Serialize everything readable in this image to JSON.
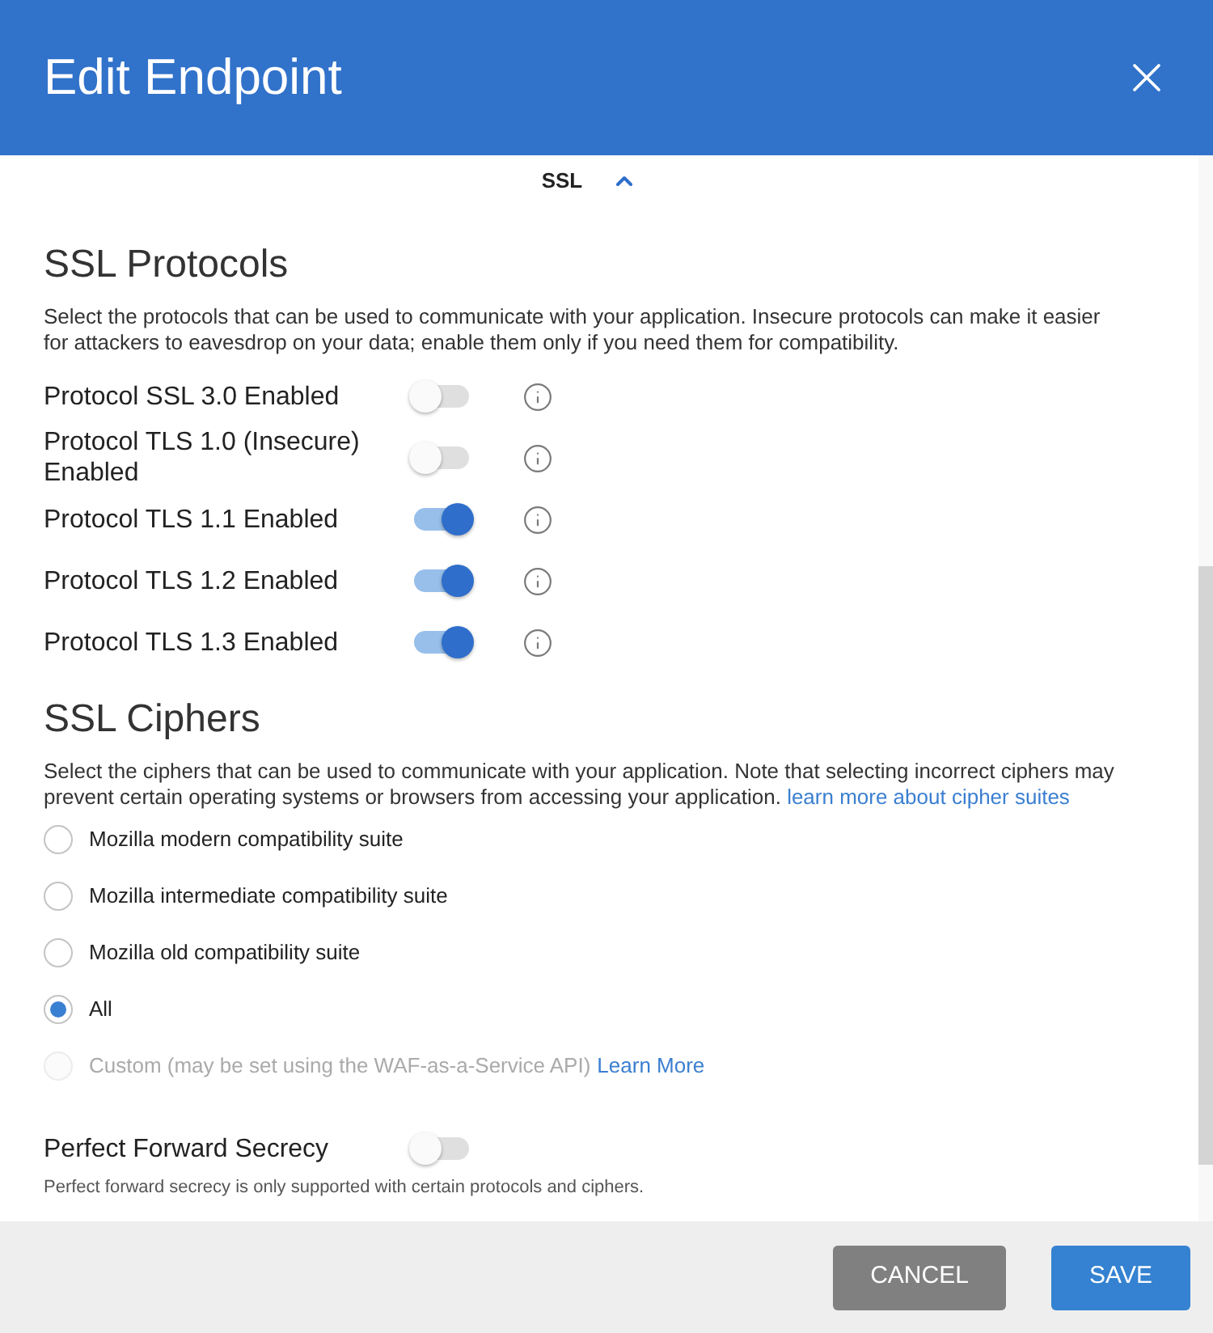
{
  "window": {
    "title": "Edit Endpoint"
  },
  "section_toggle": {
    "label": "SSL",
    "expanded": true
  },
  "protocols": {
    "heading": "SSL Protocols",
    "description": "Select the protocols that can be used to communicate with your application. Insecure protocols can make it easier for attackers to eavesdrop on your data; enable them only if you need them for compatibility.",
    "items": [
      {
        "label": "Protocol SSL 3.0 Enabled",
        "on": false
      },
      {
        "label": "Protocol TLS 1.0 (Insecure) Enabled",
        "on": false
      },
      {
        "label": "Protocol TLS 1.1 Enabled",
        "on": true
      },
      {
        "label": "Protocol TLS 1.2 Enabled",
        "on": true
      },
      {
        "label": "Protocol TLS 1.3 Enabled",
        "on": true
      }
    ]
  },
  "ciphers": {
    "heading": "SSL Ciphers",
    "description": "Select the ciphers that can be used to communicate with your application. Note that selecting incorrect ciphers may prevent certain operating systems or browsers from accessing your application.",
    "link": "learn more about cipher suites",
    "options": [
      {
        "label": "Mozilla modern compatibility suite",
        "selected": false,
        "disabled": false
      },
      {
        "label": "Mozilla intermediate compatibility suite",
        "selected": false,
        "disabled": false
      },
      {
        "label": "Mozilla old compatibility suite",
        "selected": false,
        "disabled": false
      },
      {
        "label": "All",
        "selected": true,
        "disabled": false
      },
      {
        "label": "Custom (may be set using the WAF-as-a-Service API)",
        "link": "Learn More",
        "selected": false,
        "disabled": true
      }
    ]
  },
  "forward_secrecy": {
    "label": "Perfect Forward Secrecy",
    "on": false,
    "note": "Perfect forward secrecy is only supported with certain protocols and ciphers."
  },
  "buttons": [
    {
      "label": "CANCEL",
      "kind": "secondary"
    },
    {
      "label": "SAVE",
      "kind": "primary"
    }
  ]
}
